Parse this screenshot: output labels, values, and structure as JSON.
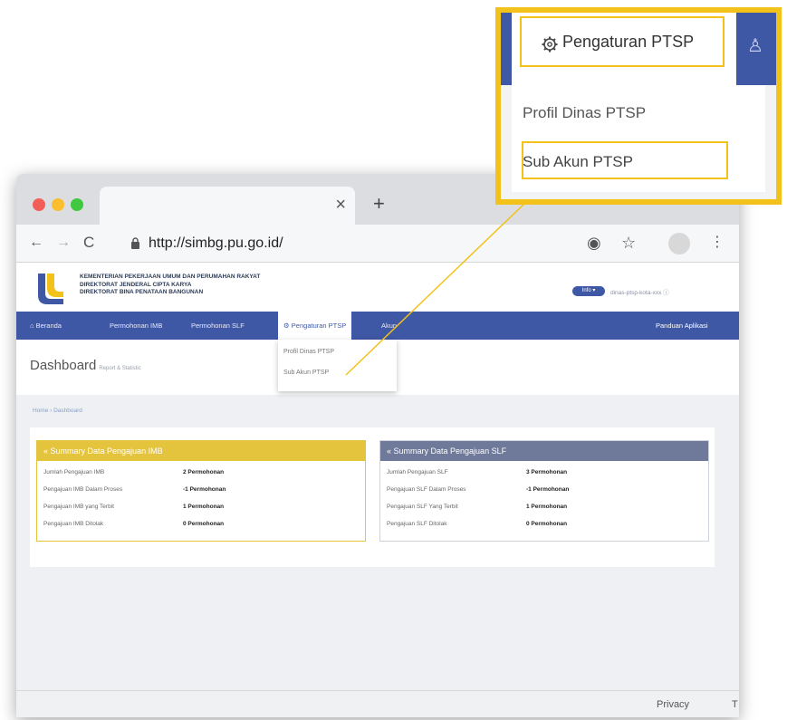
{
  "browser": {
    "url": "http://simbg.pu.go.id/",
    "tab_close": "×",
    "new_tab": "+"
  },
  "site": {
    "header_lines": [
      "KEMENTERIAN PEKERJAAN UMUM DAN PERUMAHAN RAKYAT",
      "DIREKTORAT JENDERAL CIPTA KARYA",
      "DIREKTORAT BINA PENATAAN BANGUNAN"
    ],
    "info_badge": "Info ▾",
    "user_text": "dinas-ptsp-kota-xxx ⓘ",
    "nav": {
      "beranda": "⌂ Beranda",
      "permohonan_imb": "Permohonan IMB",
      "permohonan_slf": "Permohonan SLF",
      "pengaturan_ptsp": "⚙ Pengaturan PTSP",
      "akun": "Akun",
      "panduan": "Panduan Aplikasi"
    },
    "dropdown": [
      "Profil Dinas PTSP",
      "Sub Akun PTSP"
    ],
    "page_title": "Dashboard",
    "page_subtitle": "Report & Statistic",
    "breadcrumb": "Home › Dashboard"
  },
  "cards": {
    "imb": {
      "title": "Summary Data Pengajuan IMB",
      "rows": [
        {
          "label": "Jumlah Pengajuan IMB",
          "value": "2 Permohonan"
        },
        {
          "label": "Pengajuan IMB Dalam Proses",
          "value": "-1 Permohonan"
        },
        {
          "label": "Pengajuan IMB yang Terbit",
          "value": "1 Permohonan"
        },
        {
          "label": "Pengajuan IMB Ditolak",
          "value": "0 Permohonan"
        }
      ]
    },
    "slf": {
      "title": "Summary Data Pengajuan SLF",
      "rows": [
        {
          "label": "Jumlah Pengajuan SLF",
          "value": "3 Permohonan"
        },
        {
          "label": "Pengajuan SLF Dalam Proses",
          "value": "-1 Permohonan"
        },
        {
          "label": "Pengajuan SLF Yang Terbit",
          "value": "1 Permohonan"
        },
        {
          "label": "Pengajuan SLF Ditolak",
          "value": "0 Permohonan"
        }
      ]
    }
  },
  "status_bar": {
    "privacy": "Privacy",
    "trailing": "T"
  },
  "callout": {
    "menu_title": "Pengaturan PTSP",
    "items": [
      "Profil Dinas PTSP",
      "Sub Akun PTSP"
    ]
  },
  "colors": {
    "navbar": "#3f58a5",
    "highlight": "#f2c21b",
    "imb_header": "#e4c43c",
    "slf_header": "#6f7a9a"
  }
}
